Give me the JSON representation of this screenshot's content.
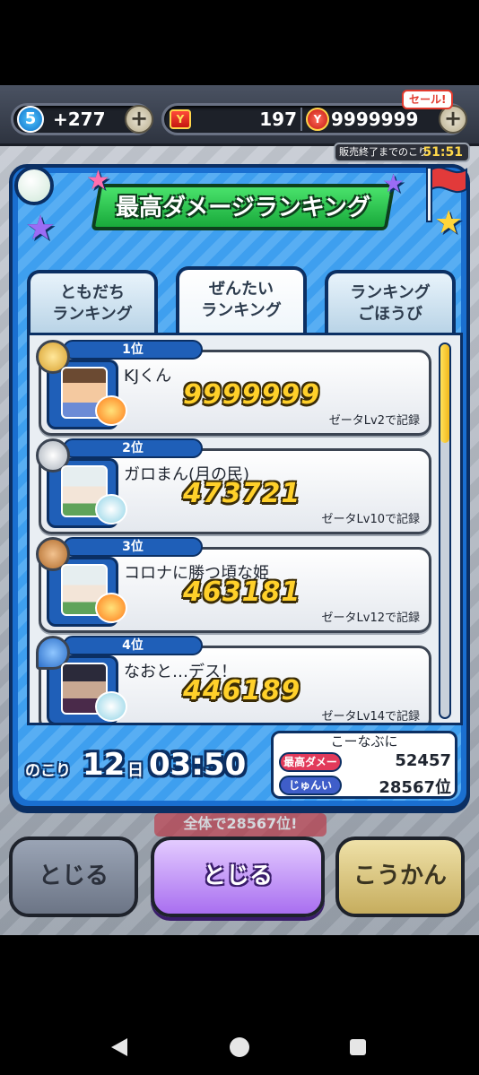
{
  "topbar": {
    "level": "5",
    "stamina": "+277",
    "plus_label": "+",
    "ticket_icon": "Y",
    "ticket_count": "197",
    "coin_icon": "Y",
    "coin_count": "9999999",
    "sale_badge": "セール!",
    "sale_timer_label": "販売終了までのこり",
    "sale_timer_value": "51:51"
  },
  "panel": {
    "title": "最高ダメージランキング",
    "tabs": [
      {
        "line1": "ともだち",
        "line2": "ランキング"
      },
      {
        "line1": "ぜんたい",
        "line2": "ランキング"
      },
      {
        "line1": "ランキング",
        "line2": "ごほうび"
      }
    ],
    "selected_tab": 1
  },
  "ranking": [
    {
      "rank": "1位",
      "name": "KJくん",
      "score": "9999999",
      "record": "ゼータLv2で記録",
      "medal": "gold"
    },
    {
      "rank": "2位",
      "name": "ガロまん(月の民)",
      "score": "473721",
      "record": "ゼータLv10で記録",
      "medal": "silver"
    },
    {
      "rank": "3位",
      "name": "コロナに勝つ頃な姫",
      "score": "463181",
      "record": "ゼータLv12で記録",
      "medal": "bronze"
    },
    {
      "rank": "4位",
      "name": "なおと…デス！",
      "score": "446189",
      "record": "ゼータLv14で記録",
      "medal": "blue"
    }
  ],
  "remaining": {
    "label": "のこり",
    "days": "12",
    "day_unit": "日",
    "time": "03:50"
  },
  "my_stats": {
    "name": "こーなぶに",
    "damage_label": "最高ダメージ",
    "damage_value": "52457",
    "rank_label": "じゅんい",
    "rank_value": "28567位"
  },
  "buttons": {
    "close_left": "とじる",
    "close_main": "とじる",
    "exchange": "こうかん"
  },
  "behind_banner": "全体で28567位!",
  "colors": {
    "panel_blue": "#1a6fd0",
    "title_green": "#19a93b",
    "score_gold": "#ffd02a",
    "button_purple": "#a96ff0"
  }
}
